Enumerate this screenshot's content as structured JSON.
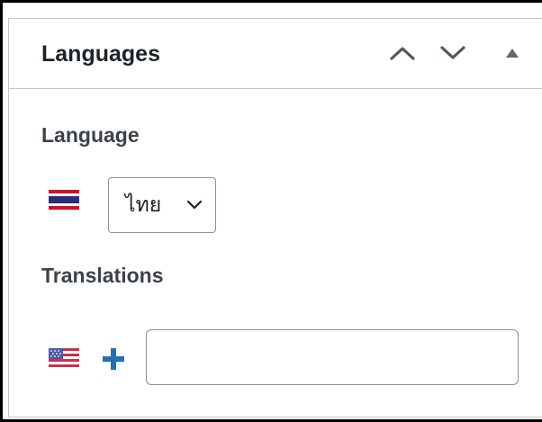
{
  "panel": {
    "title": "Languages",
    "move_up_icon": "chevron-up-icon",
    "move_down_icon": "chevron-down-icon",
    "toggle_icon": "triangle-up-icon"
  },
  "language": {
    "label": "Language",
    "flag_icon": "thai-flag-icon",
    "selected": "ไทย"
  },
  "translations": {
    "label": "Translations",
    "rows": [
      {
        "flag_icon": "us-flag-icon",
        "add_icon": "plus-icon",
        "value": ""
      }
    ]
  },
  "colors": {
    "accent": "#2271b1",
    "border": "#c3c4c7",
    "text": "#1d2327"
  }
}
